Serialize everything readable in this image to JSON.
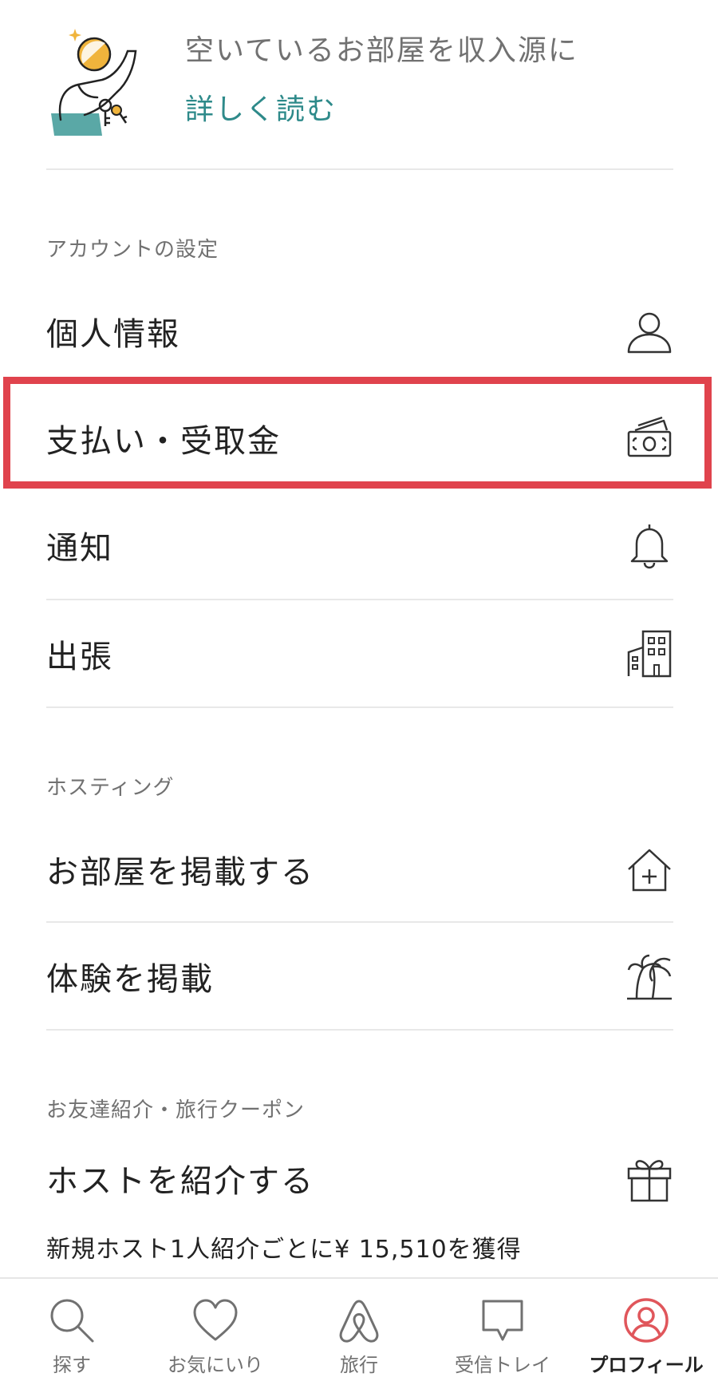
{
  "promo": {
    "title": "空いているお部屋を収入源に",
    "link": "詳しく読む"
  },
  "sections": {
    "account": {
      "label": "アカウントの設定",
      "items": [
        {
          "label": "個人情報",
          "icon": "person-icon"
        },
        {
          "label": "支払い・受取金",
          "icon": "money-icon"
        },
        {
          "label": "通知",
          "icon": "bell-icon"
        },
        {
          "label": "出張",
          "icon": "building-icon"
        }
      ]
    },
    "hosting": {
      "label": "ホスティング",
      "items": [
        {
          "label": "お部屋を掲載する",
          "icon": "house-plus-icon"
        },
        {
          "label": "体験を掲載",
          "icon": "palm-tree-icon"
        }
      ]
    },
    "referral": {
      "label": "お友達紹介・旅行クーポン",
      "items": [
        {
          "label": "ホストを紹介する",
          "sub": "新規ホスト1人紹介ごとに¥ 15,510を獲得",
          "icon": "gift-icon"
        }
      ]
    }
  },
  "highlight_color": "#e0434d",
  "accent_color": "#2e8a8a",
  "active_color": "#e0565b",
  "bottom_nav": [
    {
      "label": "探す",
      "icon": "search-icon"
    },
    {
      "label": "お気にいり",
      "icon": "heart-icon"
    },
    {
      "label": "旅行",
      "icon": "airbnb-logo-icon"
    },
    {
      "label": "受信トレイ",
      "icon": "message-icon"
    },
    {
      "label": "プロフィール",
      "icon": "profile-icon",
      "active": true
    }
  ]
}
